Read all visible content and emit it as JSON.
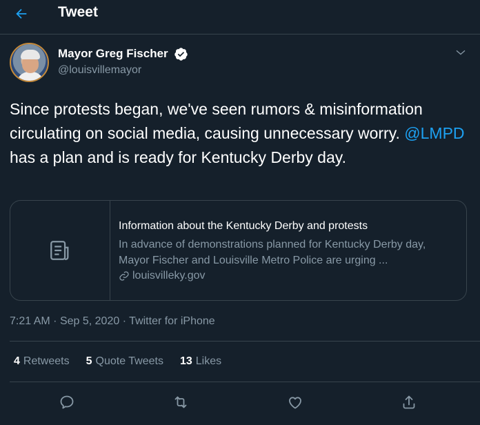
{
  "header": {
    "title": "Tweet"
  },
  "author": {
    "name": "Mayor Greg Fischer",
    "handle": "@louisvillemayor"
  },
  "tweet": {
    "text_before": "Since protests began, we've seen rumors & misinformation circulating on social media, causing unnecessary worry. ",
    "mention": "@LMPD",
    "text_after": " has a plan and is ready for Kentucky Derby day."
  },
  "card": {
    "title": "Information about the Kentucky Derby and protests",
    "description": "In advance of demonstrations planned for Kentucky Derby day, Mayor Fischer and Louisville Metro Police are urging ...",
    "domain": "louisvilleky.gov"
  },
  "meta": {
    "time": "7:21 AM",
    "date": "Sep 5, 2020",
    "source": "Twitter for iPhone",
    "separator": "·"
  },
  "stats": {
    "retweets_count": "4",
    "retweets_label": "Retweets",
    "quotes_count": "5",
    "quotes_label": "Quote Tweets",
    "likes_count": "13",
    "likes_label": "Likes"
  },
  "colors": {
    "background": "#15202b",
    "accent": "#1da1f2",
    "secondary_text": "#8899a6",
    "border": "#38444d"
  },
  "icons": [
    "back-arrow-icon",
    "verified-badge-icon",
    "chevron-down-icon",
    "article-icon",
    "link-icon",
    "reply-icon",
    "retweet-icon",
    "like-icon",
    "share-icon"
  ]
}
